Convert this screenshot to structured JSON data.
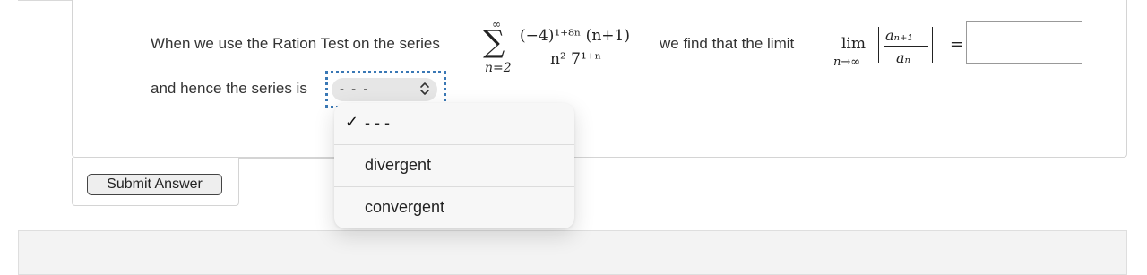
{
  "question": {
    "intro_text": "When we use the Ration Test on the series",
    "series": {
      "sum_upper": "∞",
      "sum_lower": "n=2",
      "numerator": "(−4)¹⁺⁸ⁿ (n+1)",
      "denominator": "n² 7¹⁺ⁿ"
    },
    "limit_text": "we find that the limit",
    "limit": {
      "word": "lim",
      "sub": "n→∞",
      "ratio_numerator": "aₙ₊₁",
      "ratio_denominator": "aₙ"
    },
    "equals": "=",
    "answer_value": "",
    "hence_text": "and hence the series is"
  },
  "select": {
    "value": "- - -",
    "options": [
      {
        "label": "- - -",
        "checked": true
      },
      {
        "label": "divergent",
        "checked": false
      },
      {
        "label": "convergent",
        "checked": false
      }
    ],
    "check_glyph": "✓"
  },
  "submit": {
    "label": "Submit Answer"
  },
  "icons": {
    "select": "chevron-up-down-icon",
    "checked": "checkmark-icon"
  },
  "colors": {
    "focus_outline": "#3a78b5",
    "select_bg": "#e6e6e6",
    "menu_bg": "#f7f7f7"
  }
}
